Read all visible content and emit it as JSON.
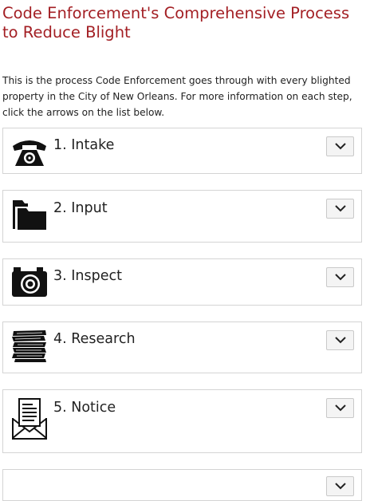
{
  "page": {
    "title": "Code Enforcement's Comprehensive Process to Reduce Blight",
    "intro": "This is the process Code Enforcement goes through with every blighted property in the City of New Orleans. For more information on each step, click the arrows on the list below."
  },
  "steps": [
    {
      "label": "1. Intake",
      "icon": "telephone-icon"
    },
    {
      "label": "2. Input",
      "icon": "folder-icon"
    },
    {
      "label": "3. Inspect",
      "icon": "camera-icon"
    },
    {
      "label": "4. Research",
      "icon": "paper-stack-icon"
    },
    {
      "label": "5. Notice",
      "icon": "letter-envelope-icon"
    }
  ],
  "colors": {
    "title": "#a31f24",
    "border": "#d4d4d4",
    "toggle_bg": "#f4f4f4"
  }
}
